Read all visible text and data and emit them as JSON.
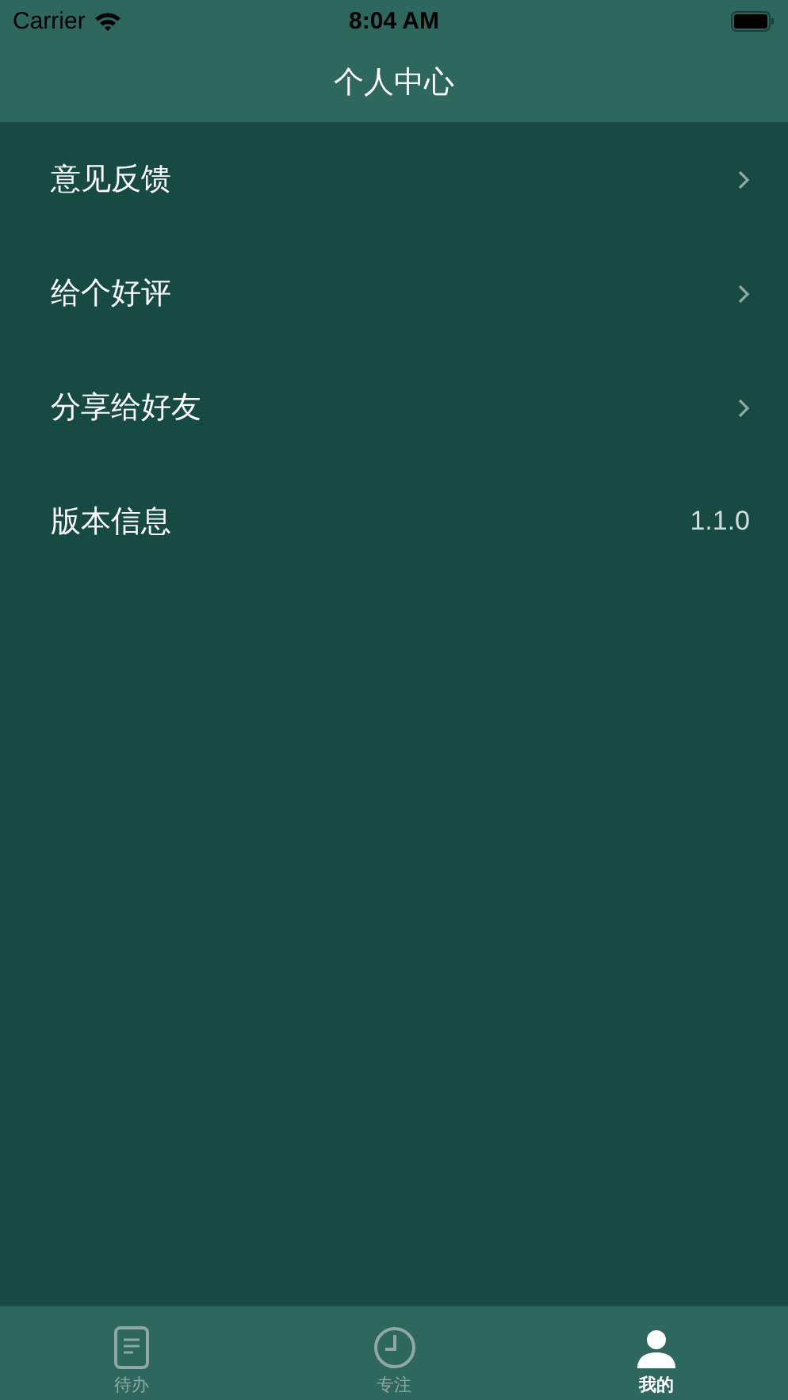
{
  "status_bar": {
    "carrier": "Carrier",
    "time": "8:04 AM"
  },
  "nav_bar": {
    "title": "个人中心"
  },
  "menu": [
    {
      "kind": "link",
      "label": "意见反馈"
    },
    {
      "kind": "link",
      "label": "给个好评"
    },
    {
      "kind": "link",
      "label": "分享给好友"
    },
    {
      "kind": "value",
      "label": "版本信息",
      "value": "1.1.0"
    }
  ],
  "tab_bar": [
    {
      "label": "待办",
      "kind": "todo",
      "selected": false
    },
    {
      "label": "专注",
      "kind": "focus",
      "selected": false
    },
    {
      "label": "我的",
      "kind": "profile",
      "selected": true
    }
  ]
}
